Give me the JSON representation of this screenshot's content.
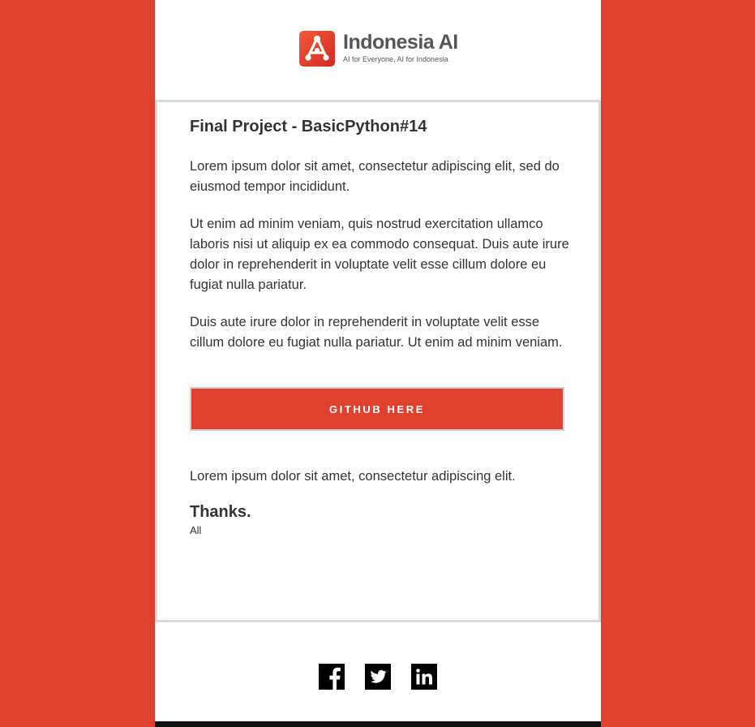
{
  "brand": {
    "name": "Indonesia AI",
    "tagline": "AI for Everyone, AI for Indonesia",
    "accent_color": "#e0412e",
    "logo_icon": "indonesia-ai-logo-icon"
  },
  "content": {
    "title": "Final Project - BasicPython#14",
    "paragraphs": [
      "Lorem ipsum dolor sit amet, consectetur adipiscing elit, sed do eiusmod tempor incididunt.",
      "Ut enim ad minim veniam, quis nostrud exercitation ullamco laboris nisi ut aliquip ex ea commodo consequat. Duis aute irure dolor in reprehenderit in voluptate velit esse cillum dolore eu fugiat nulla pariatur.",
      "Duis aute irure dolor in reprehenderit in voluptate velit esse cillum dolore eu fugiat nulla pariatur. Ut enim ad minim veniam."
    ],
    "cta_label": "GITHUB HERE",
    "after_cta": "Lorem ipsum dolor sit amet, consectetur adipiscing elit.",
    "thanks": "Thanks.",
    "signature": "All"
  },
  "footer": {
    "social": [
      {
        "name": "Facebook",
        "icon": "facebook-icon"
      },
      {
        "name": "Twitter",
        "icon": "twitter-icon"
      },
      {
        "name": "LinkedIn",
        "icon": "linkedin-icon"
      }
    ]
  }
}
